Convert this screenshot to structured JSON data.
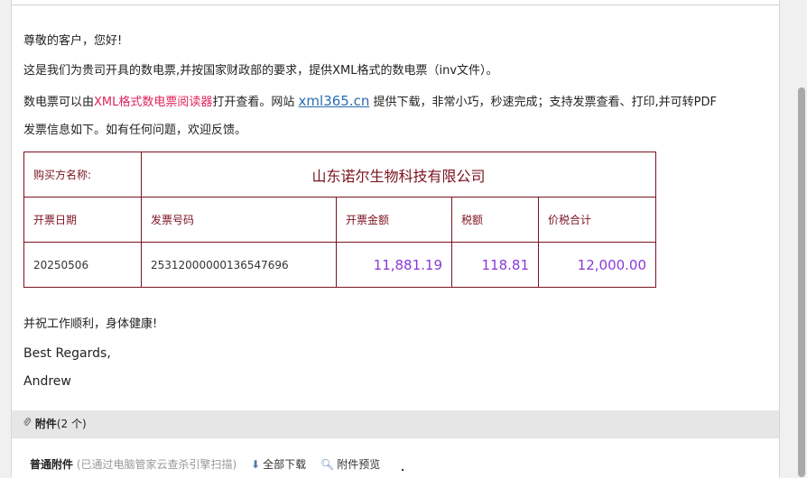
{
  "greeting": "尊敬的客户，您好!",
  "line1": "这是我们为贵司开具的数电票,并按国家财政部的要求，提供XML格式的数电票（inv文件）。",
  "line2": {
    "prefix": "数电票可以由",
    "reader_link": "XML格式数电票阅读器",
    "middle": "打开查看。网站 ",
    "site_link": "xml365.cn",
    "suffix": " 提供下载，非常小巧，秒速完成；支持发票查看、打印,并可转PDF"
  },
  "line3": "发票信息如下。如有任何问题，欢迎反馈。",
  "invoice": {
    "buyer_label": "购买方名称:",
    "buyer_name": "山东诺尔生物科技有限公司",
    "headers": {
      "date": "开票日期",
      "number": "发票号码",
      "amount": "开票金额",
      "tax": "税额",
      "total": "价税合计"
    },
    "values": {
      "date": "20250506",
      "number": "25312000000136547696",
      "amount": "11,881.19",
      "tax": "118.81",
      "total": "12,000.00"
    }
  },
  "closing": "并祝工作顺利，身体健康!",
  "regards": "Best Regards,",
  "signature": "Andrew",
  "attachments": {
    "title": "附件",
    "count": "(2 个)",
    "section_label": "普通附件",
    "scan_note": "(已通过电脑管家云查杀引擎扫描)",
    "download_all": "全部下载",
    "preview": "附件预览"
  },
  "colors": {
    "invoice_border": "#7b1320",
    "amount_text": "#8a3ad8",
    "reader_link": "#e0245e",
    "site_link": "#2b6cb0"
  }
}
